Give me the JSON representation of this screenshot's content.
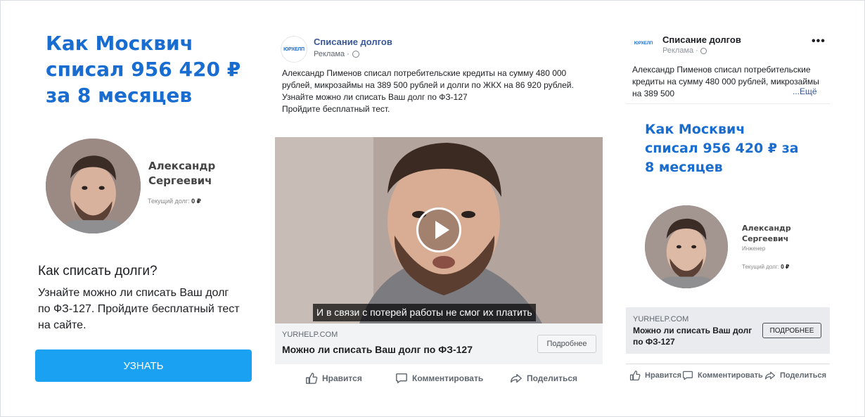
{
  "left_card": {
    "headline": "Как Москвич списал 956 420 ₽ за 8 месяцев",
    "person_name": "Александр Сергеевич",
    "debt_label": "Текущий долг:",
    "debt_value": "0 ₽",
    "question": "Как списать долги?",
    "description": "Узнайте можно ли списать Ваш долг по ФЗ-127. Пройдите бесплатный тест на сайте.",
    "cta_label": "УЗНАТЬ",
    "cta_color": "#1aa1f2"
  },
  "mid_post": {
    "logo_text": "ЮРХЕЛП",
    "page_name": "Списание долгов",
    "sponsored": "Реклама · ",
    "body_line1": "Александр Пименов списал потребительские кредиты на сумму 480 000 рублей, микрозаймы на 389 500 рублей и долги по ЖКХ на 86 920 рублей.",
    "body_line2": "Узнайте можно ли списать Ваш долг по ФЗ-127",
    "body_line3": "Пройдите бесплатный тест.",
    "video_subtitle": "И в связи с потерей работы не смог их платить",
    "domain": "YURHELP.COM",
    "link_title": "Можно ли списать Ваш долг по ФЗ-127",
    "more_button": "Подробнее",
    "actions": {
      "like": "Нравится",
      "comment": "Комментировать",
      "share": "Поделиться"
    }
  },
  "right_post": {
    "logo_text": "ЮРХЕЛП",
    "page_name": "Списание долгов",
    "sponsored": "Реклама · ",
    "more_options": "•••",
    "body_text": "Александр Пименов списал потребительские кредиты на сумму 480 000 рублей, микрозаймы на 389 500",
    "see_more": "...Ещё",
    "headline": "Как Москвич списал 956 420 ₽ за 8 месяцев",
    "person_name": "Александр Сергеевич",
    "job": "Инженер",
    "debt_label": "Текущий долг:",
    "debt_value": "0 ₽",
    "domain": "YURHELP.COM",
    "link_title": "Можно ли списать Ваш долг по ФЗ-127",
    "more_button": "ПОДРОБНЕЕ",
    "actions": {
      "like": "Нравится",
      "comment": "Комментировать",
      "share": "Поделиться"
    }
  },
  "colors": {
    "brand_blue": "#1a6dd0",
    "facebook_link": "#385898",
    "text_gray": "#606770"
  },
  "icons": [
    "globe-icon",
    "play-icon",
    "like-icon",
    "comment-icon",
    "share-icon",
    "more-options-icon"
  ]
}
